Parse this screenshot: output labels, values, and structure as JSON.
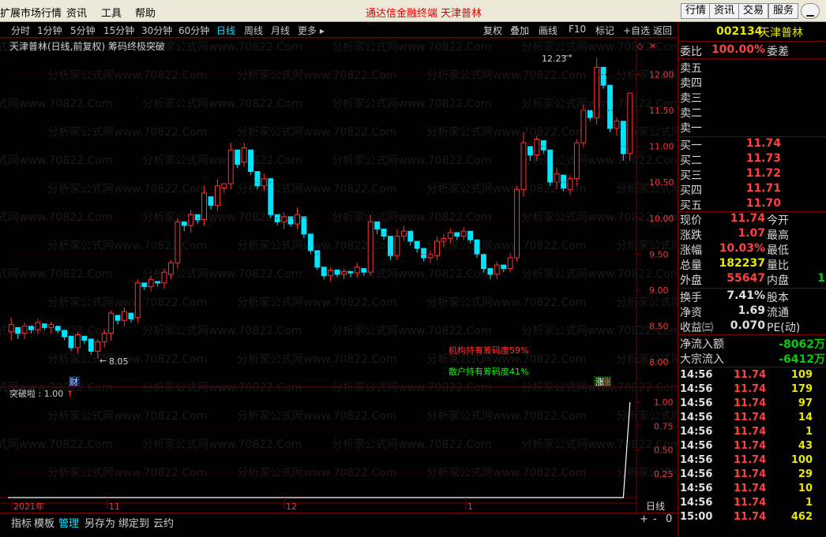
{
  "menubar": {
    "items": [
      "扩展市场行情",
      "资讯",
      "工具",
      "帮助"
    ],
    "center_title": "通达信金融终端",
    "center_stock": "天津普林",
    "right_buttons": [
      "行情",
      "资讯",
      "交易",
      "服务"
    ]
  },
  "toolbar": {
    "periods": [
      "分时",
      "1分钟",
      "5分钟",
      "15分钟",
      "30分钟",
      "60分钟",
      "日线",
      "周线",
      "月线",
      "更多 ▸"
    ],
    "active_period": "日线",
    "tools": [
      "复权",
      "叠加",
      "画线",
      "F10",
      "标记",
      "+自选",
      "返回"
    ]
  },
  "chart": {
    "title": "天津普林(日线,前复权) 筹码终极突破",
    "high_label": "12.23",
    "low_label": "8.05",
    "annot_inst": "机构持有筹码度59%",
    "annot_retail": "散户持有筹码度41%",
    "fin_badge": "财",
    "limit_badge": "涨",
    "price_ticks": [
      "12.00",
      "11.50",
      "11.00",
      "10.50",
      "10.00",
      "9.50",
      "9.00",
      "8.50",
      "8.00"
    ],
    "date_labels": [
      "2021年",
      "11",
      "12",
      "1"
    ],
    "period_label": "日线",
    "watermark": "分析家公式网www.70822.Com",
    "colors": {
      "up": "#ff3232",
      "down": "#00e5ff",
      "bg": "#000000",
      "grid": "#7a0000"
    }
  },
  "indicator": {
    "label": "突破啦 : 1.00",
    "ticks": [
      "1.00",
      "0.75",
      "0.50",
      "0.25"
    ]
  },
  "chart_data": {
    "type": "line",
    "title": "突破啦",
    "xlabel": "",
    "ylabel": "",
    "ylim": [
      0,
      1
    ],
    "x": [
      1,
      2,
      3,
      4,
      5,
      6,
      7,
      8,
      9,
      10
    ],
    "values": [
      0,
      0,
      0,
      0,
      0,
      0,
      0,
      0,
      0,
      1
    ]
  },
  "quote": {
    "code": "002134",
    "name": "天津普林",
    "weibi_label": "委比",
    "weibi_value": "100.00%",
    "weicha_label": "委差",
    "sell": [
      {
        "label": "卖五"
      },
      {
        "label": "卖四"
      },
      {
        "label": "卖三"
      },
      {
        "label": "卖二"
      },
      {
        "label": "卖一"
      }
    ],
    "buy": [
      {
        "label": "买一",
        "price": "11.74"
      },
      {
        "label": "买二",
        "price": "11.73"
      },
      {
        "label": "买三",
        "price": "11.72"
      },
      {
        "label": "买四",
        "price": "11.71"
      },
      {
        "label": "买五",
        "price": "11.70"
      }
    ],
    "stats": [
      {
        "l": "现价",
        "v": "11.74",
        "c": "red",
        "l2": "今开"
      },
      {
        "l": "涨跌",
        "v": "1.07",
        "c": "red",
        "l2": "最高"
      },
      {
        "l": "涨幅",
        "v": "10.03%",
        "c": "red",
        "l2": "最低"
      },
      {
        "l": "总量",
        "v": "182237",
        "c": "yellow",
        "l2": "量比"
      },
      {
        "l": "外盘",
        "v": "55647",
        "c": "red",
        "l2": "内盘",
        "v2": "1"
      }
    ],
    "stats2": [
      {
        "l": "换手",
        "v": "7.41%",
        "l2": "股本"
      },
      {
        "l": "净资",
        "v": "1.69",
        "l2": "流通"
      },
      {
        "l": "收益㈢",
        "v": "0.070",
        "l2": "PE(动)"
      }
    ],
    "flow": [
      {
        "l": "净流入额",
        "v": "-8062万"
      },
      {
        "l": "大宗流入",
        "v": "-6412万"
      }
    ],
    "ticks": [
      {
        "t": "14:56",
        "p": "11.74",
        "v": "109"
      },
      {
        "t": "14:56",
        "p": "11.74",
        "v": "179"
      },
      {
        "t": "14:56",
        "p": "11.74",
        "v": "97"
      },
      {
        "t": "14:56",
        "p": "11.74",
        "v": "14"
      },
      {
        "t": "14:56",
        "p": "11.74",
        "v": "1"
      },
      {
        "t": "14:56",
        "p": "11.74",
        "v": "43"
      },
      {
        "t": "14:56",
        "p": "11.74",
        "v": "100"
      },
      {
        "t": "14:56",
        "p": "11.74",
        "v": "29"
      },
      {
        "t": "14:56",
        "p": "11.74",
        "v": "10"
      },
      {
        "t": "14:56",
        "p": "11.74",
        "v": "1"
      },
      {
        "t": "15:00",
        "p": "11.74",
        "v": "462"
      }
    ]
  },
  "bottombar": {
    "tabs": [
      "指标",
      "模板",
      "管理",
      "另存为",
      "绑定到",
      "云约"
    ],
    "active": "管理",
    "zoom_plus": "+",
    "zoom_minus": "-",
    "zoom_zero": "0"
  },
  "candles": [
    [
      8.42,
      8.52,
      8.35,
      8.3,
      8.62
    ],
    [
      8.48,
      8.4,
      8.32,
      8.56,
      8.45
    ],
    [
      8.4,
      8.5,
      8.38,
      8.32,
      8.55
    ],
    [
      8.5,
      8.45,
      8.4,
      8.56,
      8.48
    ],
    [
      8.45,
      8.55,
      8.42,
      8.38,
      8.6
    ],
    [
      8.53,
      8.48,
      8.45,
      8.6,
      8.51
    ],
    [
      8.48,
      8.52,
      8.44,
      8.4,
      8.56
    ],
    [
      8.5,
      8.44,
      8.4,
      8.55,
      8.47
    ],
    [
      8.44,
      8.35,
      8.3,
      8.48,
      8.38
    ],
    [
      8.36,
      8.2,
      8.15,
      8.4,
      8.22
    ],
    [
      8.2,
      8.38,
      8.15,
      8.12,
      8.42
    ],
    [
      8.36,
      8.3,
      8.25,
      8.4,
      8.32
    ],
    [
      8.32,
      8.15,
      8.1,
      8.36,
      8.18
    ],
    [
      8.15,
      8.28,
      8.1,
      8.05,
      8.32
    ],
    [
      8.28,
      8.4,
      8.25,
      8.2,
      8.45
    ],
    [
      8.4,
      8.68,
      8.35,
      8.3,
      8.72
    ],
    [
      8.65,
      8.58,
      8.52,
      8.75,
      8.6
    ],
    [
      8.58,
      8.7,
      8.55,
      8.5,
      8.76
    ],
    [
      8.68,
      8.6,
      8.55,
      8.72,
      8.62
    ],
    [
      8.62,
      9.1,
      8.58,
      8.55,
      9.15
    ],
    [
      9.1,
      9.05,
      9.0,
      9.22,
      9.08
    ],
    [
      9.05,
      9.15,
      9.02,
      8.98,
      9.2
    ],
    [
      9.12,
      9.1,
      9.05,
      9.18,
      9.11
    ],
    [
      9.1,
      9.25,
      9.05,
      9.02,
      9.3
    ],
    [
      9.22,
      9.38,
      9.18,
      9.15,
      9.42
    ],
    [
      9.38,
      9.95,
      9.32,
      9.3,
      10.0
    ],
    [
      9.95,
      9.9,
      9.82,
      10.02,
      9.93
    ],
    [
      9.9,
      10.05,
      9.88,
      9.8,
      10.12
    ],
    [
      10.05,
      9.98,
      9.92,
      10.1,
      10.0
    ],
    [
      9.98,
      10.35,
      9.95,
      9.9,
      10.45
    ],
    [
      10.3,
      10.18,
      10.12,
      10.45,
      10.22
    ],
    [
      10.18,
      10.45,
      10.15,
      10.1,
      10.55
    ],
    [
      10.42,
      10.48,
      10.35,
      10.55,
      10.45
    ],
    [
      10.48,
      10.95,
      10.42,
      10.4,
      11.05
    ],
    [
      10.95,
      10.75,
      10.7,
      11.1,
      10.8
    ],
    [
      10.78,
      10.98,
      10.75,
      10.72,
      11.05
    ],
    [
      10.95,
      10.65,
      10.6,
      11.0,
      10.7
    ],
    [
      10.65,
      10.45,
      10.4,
      10.72,
      10.5
    ],
    [
      10.45,
      10.55,
      10.4,
      10.38,
      10.62
    ],
    [
      10.55,
      10.05,
      10.0,
      10.6,
      10.1
    ],
    [
      10.05,
      9.95,
      9.9,
      10.1,
      9.98
    ],
    [
      9.95,
      10.02,
      9.9,
      9.85,
      10.08
    ],
    [
      10.02,
      9.92,
      9.88,
      10.06,
      9.95
    ],
    [
      9.92,
      10.05,
      9.9,
      9.85,
      10.15
    ],
    [
      10.02,
      9.78,
      9.72,
      10.06,
      9.8
    ],
    [
      9.78,
      9.55,
      9.5,
      9.82,
      9.58
    ],
    [
      9.55,
      9.32,
      9.28,
      9.6,
      9.36
    ],
    [
      9.32,
      9.2,
      9.15,
      9.38,
      9.24
    ],
    [
      9.2,
      9.28,
      9.18,
      9.12,
      9.32
    ],
    [
      9.28,
      9.22,
      9.18,
      9.32,
      9.24
    ],
    [
      9.22,
      9.26,
      9.2,
      9.15,
      9.3
    ],
    [
      9.26,
      9.24,
      9.18,
      9.3,
      9.25
    ],
    [
      9.24,
      9.32,
      9.22,
      9.18,
      9.38
    ],
    [
      9.3,
      9.25,
      9.2,
      9.36,
      9.27
    ],
    [
      9.25,
      9.95,
      9.22,
      9.2,
      10.05
    ],
    [
      9.95,
      9.85,
      9.78,
      10.0,
      9.88
    ],
    [
      9.85,
      9.75,
      9.7,
      9.92,
      9.78
    ],
    [
      9.75,
      9.48,
      9.42,
      9.8,
      9.5
    ],
    [
      9.48,
      9.75,
      9.45,
      9.42,
      9.85
    ],
    [
      9.75,
      9.82,
      9.7,
      9.68,
      9.9
    ],
    [
      9.82,
      9.68,
      9.62,
      9.88,
      9.7
    ],
    [
      9.68,
      9.58,
      9.52,
      9.74,
      9.6
    ],
    [
      9.58,
      9.45,
      9.4,
      9.62,
      9.48
    ],
    [
      9.45,
      9.5,
      9.4,
      9.38,
      9.55
    ],
    [
      9.48,
      9.68,
      9.45,
      9.42,
      9.75
    ],
    [
      9.68,
      9.72,
      9.62,
      9.6,
      9.78
    ],
    [
      9.72,
      9.8,
      9.68,
      9.65,
      9.86
    ],
    [
      9.8,
      9.75,
      9.7,
      9.85,
      9.78
    ],
    [
      9.75,
      9.82,
      9.72,
      9.7,
      9.88
    ],
    [
      9.82,
      9.7,
      9.65,
      9.86,
      9.72
    ],
    [
      9.7,
      9.5,
      9.45,
      9.75,
      9.52
    ],
    [
      9.5,
      9.3,
      9.25,
      9.55,
      9.32
    ],
    [
      9.3,
      9.22,
      9.15,
      9.36,
      9.24
    ],
    [
      9.22,
      9.35,
      9.18,
      9.15,
      9.4
    ],
    [
      9.35,
      9.3,
      9.25,
      9.4,
      9.32
    ],
    [
      9.3,
      9.45,
      9.28,
      9.25,
      9.52
    ],
    [
      9.45,
      10.4,
      9.42,
      9.4,
      10.45
    ],
    [
      10.4,
      11.05,
      10.35,
      10.3,
      11.2
    ],
    [
      11.0,
      10.88,
      10.8,
      11.1,
      10.92
    ],
    [
      10.88,
      11.1,
      10.85,
      10.8,
      11.15
    ],
    [
      11.08,
      10.95,
      10.9,
      11.12,
      10.98
    ],
    [
      10.95,
      10.5,
      10.45,
      11.0,
      10.55
    ],
    [
      10.5,
      10.62,
      10.45,
      10.4,
      10.7
    ],
    [
      10.6,
      10.42,
      10.38,
      10.65,
      10.45
    ],
    [
      10.4,
      10.55,
      10.35,
      10.32,
      10.6
    ],
    [
      10.55,
      11.05,
      10.5,
      10.45,
      11.1
    ],
    [
      11.05,
      11.5,
      11.0,
      10.98,
      11.58
    ],
    [
      11.5,
      11.4,
      11.35,
      11.62,
      11.45
    ],
    [
      11.4,
      12.1,
      11.35,
      11.3,
      12.23
    ],
    [
      12.1,
      11.85,
      11.8,
      12.18,
      11.9
    ],
    [
      11.85,
      11.25,
      11.2,
      11.95,
      11.3
    ],
    [
      11.25,
      11.35,
      11.2,
      11.15,
      11.4
    ],
    [
      11.35,
      10.9,
      10.8,
      11.4,
      10.95
    ],
    [
      10.9,
      11.74,
      10.85,
      10.8,
      11.74
    ]
  ]
}
